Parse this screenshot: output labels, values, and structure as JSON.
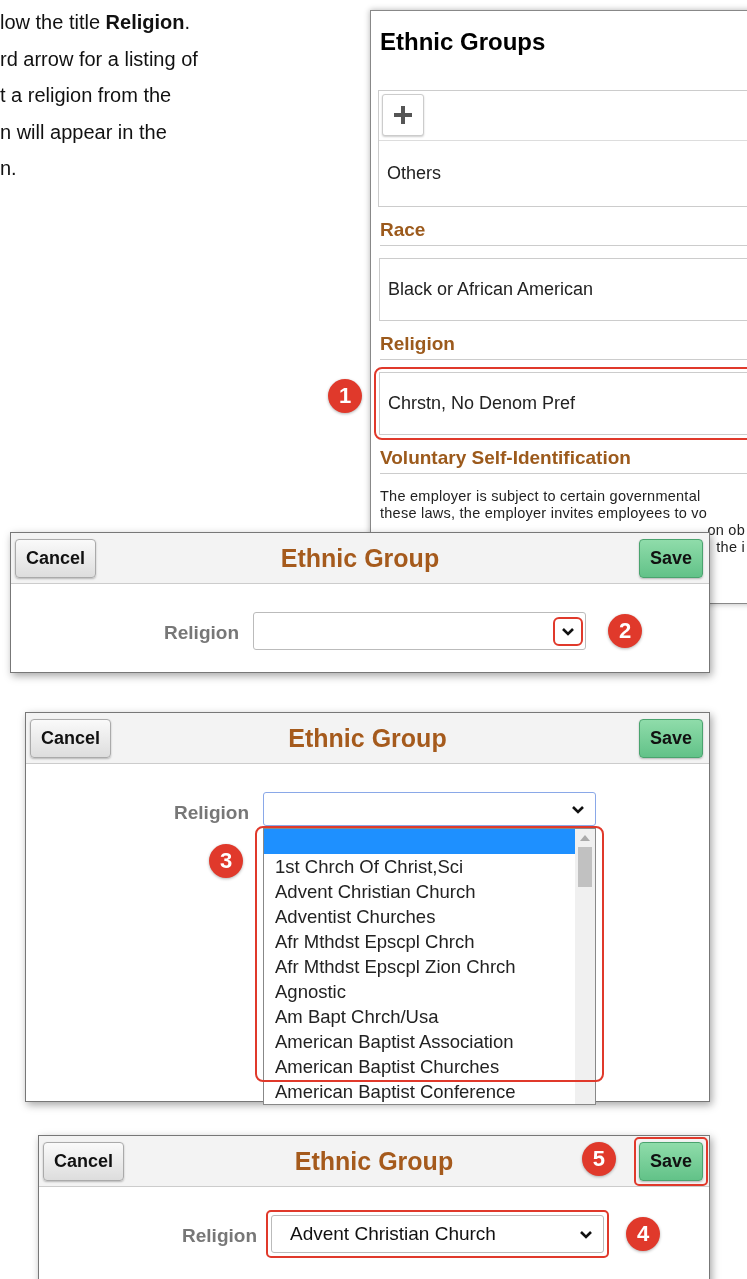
{
  "instructions": [
    {
      "text": "low the title **Religion**."
    },
    {
      "text": "rd arrow for a listing of"
    },
    {
      "text": "t a religion from the"
    },
    {
      "text": "n will appear in the"
    },
    {
      "text": "n."
    }
  ],
  "panel": {
    "title": "Ethnic Groups",
    "rows": [
      "Others"
    ],
    "sections": [
      {
        "kind": "value",
        "heading": "Race",
        "value": "Black or African American",
        "highlighted": false
      },
      {
        "kind": "value",
        "heading": "Religion",
        "value": "Chrstn, No Denom Pref",
        "highlighted": true,
        "step": "1"
      },
      {
        "kind": "text",
        "heading": "Voluntary Self-Identification",
        "lines": [
          "The employer is subject to certain governmental",
          "these laws, the employer invites employees to vo",
          "on ob",
          "the i"
        ]
      }
    ]
  },
  "dialogs": [
    {
      "title": "Ethnic Group",
      "cancel": {
        "label": "Cancel"
      },
      "save": {
        "label": "Save",
        "highlighted": false
      },
      "field": {
        "label": "Religion",
        "expanded": false,
        "chevron_highlighted": true,
        "step": "2"
      }
    },
    {
      "title": "Ethnic Group",
      "cancel": {
        "label": "Cancel"
      },
      "save": {
        "label": "Save",
        "highlighted": false
      },
      "field": {
        "label": "Religion",
        "expanded": true,
        "list_highlighted": true,
        "step": "3",
        "options": [
          {
            "selected": true
          },
          {
            "label": "1st Chrch Of Christ,Sci",
            "selected": false
          },
          {
            "label": "Advent Christian Church",
            "selected": false
          },
          {
            "label": "Adventist Churches",
            "selected": false
          },
          {
            "label": "Afr Mthdst Epscpl Chrch",
            "selected": false
          },
          {
            "label": "Afr Mthdst Epscpl Zion Chrch",
            "selected": false
          },
          {
            "label": "Agnostic",
            "selected": false
          },
          {
            "label": "Am Bapt Chrch/Usa",
            "selected": false
          },
          {
            "label": "American Baptist Association",
            "selected": false
          },
          {
            "label": "American Baptist Churches",
            "selected": false
          },
          {
            "label": "American Baptist Conference",
            "selected": false
          }
        ]
      }
    },
    {
      "title": "Ethnic Group",
      "cancel": {
        "label": "Cancel"
      },
      "save": {
        "label": "Save",
        "highlighted": true,
        "step": "5"
      },
      "field": {
        "label": "Religion",
        "value": "Advent Christian Church",
        "expanded": false,
        "field_highlighted": true,
        "step": "4"
      }
    }
  ]
}
